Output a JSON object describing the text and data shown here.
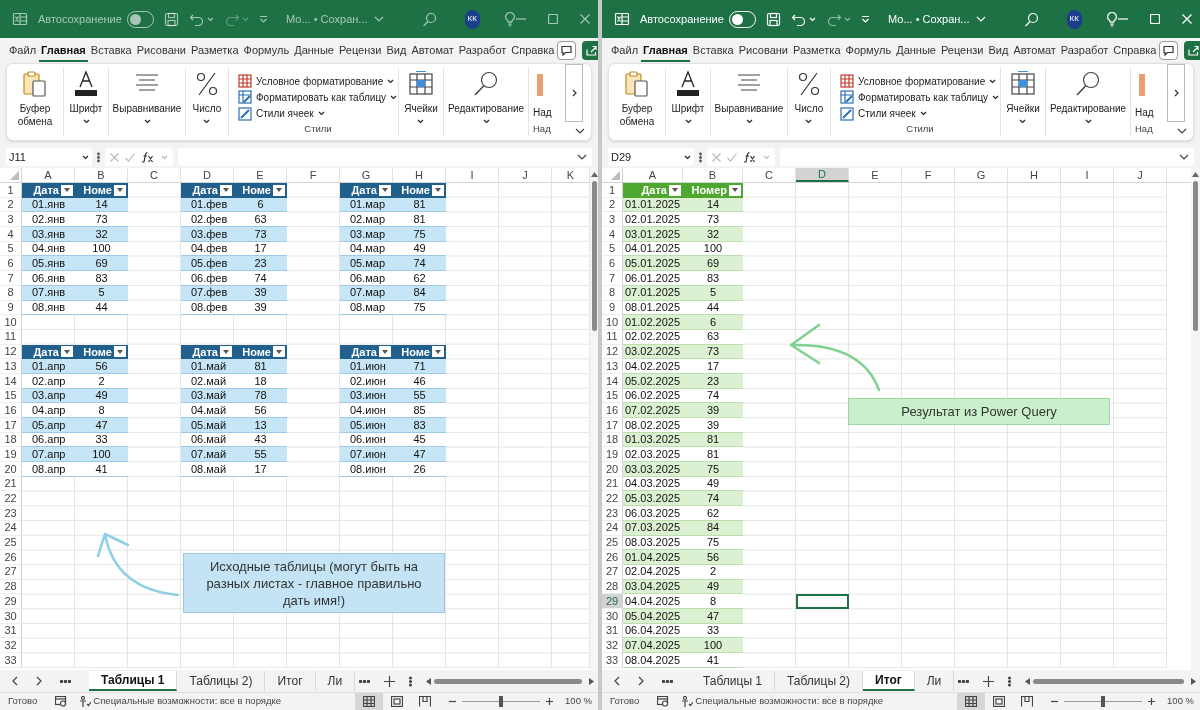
{
  "windows": [
    {
      "active": false,
      "title_bar": {
        "autosave_label": "Автосохранение",
        "autosave_on": false,
        "doc_title": "Мо... • Сохран...",
        "avatar": "КК"
      },
      "menu_tabs": [
        {
          "label": "Файл",
          "selected": false
        },
        {
          "label": "Главная",
          "selected": true
        },
        {
          "label": "Вставка",
          "selected": false
        },
        {
          "label": "Рисовани",
          "selected": false
        },
        {
          "label": "Разметка",
          "selected": false
        },
        {
          "label": "Формуль",
          "selected": false
        },
        {
          "label": "Данные",
          "selected": false
        },
        {
          "label": "Рецензи",
          "selected": false
        },
        {
          "label": "Вид",
          "selected": false
        },
        {
          "label": "Автомат",
          "selected": false
        },
        {
          "label": "Разработ",
          "selected": false
        },
        {
          "label": "Справка",
          "selected": false
        }
      ],
      "ribbon": {
        "groups": [
          {
            "kind": "clipboard",
            "label": "Буфер обмена"
          },
          {
            "kind": "font",
            "label": "Шрифт"
          },
          {
            "kind": "align",
            "label": "Выравнивание"
          },
          {
            "kind": "number",
            "label": "Число"
          },
          {
            "kind": "styles",
            "items": [
              "Условное форматирование",
              "Форматировать как таблицу",
              "Стили ячеек"
            ],
            "label": "Стили"
          },
          {
            "kind": "cells",
            "label": "Ячейки"
          },
          {
            "kind": "editing",
            "label": "Редактирование"
          },
          {
            "kind": "cut",
            "label": "Над",
            "footer": "Над"
          }
        ]
      },
      "name_box": "J11",
      "sheet": {
        "columns": [
          {
            "label": "A",
            "selected": false
          },
          {
            "label": "B",
            "selected": false
          },
          {
            "label": "C",
            "selected": false
          },
          {
            "label": "D",
            "selected": false
          },
          {
            "label": "E",
            "selected": false
          },
          {
            "label": "F",
            "selected": false
          },
          {
            "label": "G",
            "selected": false
          },
          {
            "label": "H",
            "selected": false
          },
          {
            "label": "I",
            "selected": false
          },
          {
            "label": "J",
            "selected": false
          },
          {
            "label": "K",
            "selected": false
          }
        ],
        "rows": [
          {
            "label": "1",
            "selected": false
          },
          {
            "label": "2",
            "selected": false
          },
          {
            "label": "3",
            "selected": false
          },
          {
            "label": "4",
            "selected": false
          },
          {
            "label": "5",
            "selected": false
          },
          {
            "label": "6",
            "selected": false
          },
          {
            "label": "7",
            "selected": false
          },
          {
            "label": "8",
            "selected": false
          },
          {
            "label": "9",
            "selected": false
          },
          {
            "label": "10",
            "selected": false
          },
          {
            "label": "11",
            "selected": false
          },
          {
            "label": "12",
            "selected": false
          },
          {
            "label": "13",
            "selected": false
          },
          {
            "label": "14",
            "selected": false
          },
          {
            "label": "15",
            "selected": false
          },
          {
            "label": "16",
            "selected": false
          },
          {
            "label": "17",
            "selected": false
          },
          {
            "label": "18",
            "selected": false
          },
          {
            "label": "19",
            "selected": false
          },
          {
            "label": "20",
            "selected": false
          },
          {
            "label": "21",
            "selected": false
          },
          {
            "label": "22",
            "selected": false
          },
          {
            "label": "23",
            "selected": false
          },
          {
            "label": "24",
            "selected": false
          },
          {
            "label": "25",
            "selected": false
          },
          {
            "label": "26",
            "selected": false
          },
          {
            "label": "27",
            "selected": false
          },
          {
            "label": "28",
            "selected": false
          },
          {
            "label": "29",
            "selected": false
          },
          {
            "label": "30",
            "selected": false
          },
          {
            "label": "31",
            "selected": false
          },
          {
            "label": "32",
            "selected": false
          },
          {
            "label": "33",
            "selected": false
          }
        ],
        "tables": [
          {
            "header": [
              "Дата",
              "Номе"
            ],
            "rows": [
              [
                "01.янв",
                "14"
              ],
              [
                "02.янв",
                "73"
              ],
              [
                "03.янв",
                "32"
              ],
              [
                "04.янв",
                "100"
              ],
              [
                "05.янв",
                "69"
              ],
              [
                "06.янв",
                "83"
              ],
              [
                "07.янв",
                "5"
              ],
              [
                "08.янв",
                "44"
              ]
            ]
          },
          {
            "header": [
              "Дата",
              "Номе"
            ],
            "rows": [
              [
                "01.фев",
                "6"
              ],
              [
                "02.фев",
                "63"
              ],
              [
                "03.фев",
                "73"
              ],
              [
                "04.фев",
                "17"
              ],
              [
                "05.фев",
                "23"
              ],
              [
                "06.фев",
                "74"
              ],
              [
                "07.фев",
                "39"
              ],
              [
                "08.фев",
                "39"
              ]
            ]
          },
          {
            "header": [
              "Дата",
              "Номе"
            ],
            "rows": [
              [
                "01.мар",
                "81"
              ],
              [
                "02.мар",
                "81"
              ],
              [
                "03.мар",
                "75"
              ],
              [
                "04.мар",
                "49"
              ],
              [
                "05.мар",
                "74"
              ],
              [
                "06.мар",
                "62"
              ],
              [
                "07.мар",
                "84"
              ],
              [
                "08.мар",
                "75"
              ]
            ]
          },
          {
            "header": [
              "Дата",
              "Номе"
            ],
            "rows": [
              [
                "01.апр",
                "56"
              ],
              [
                "02.апр",
                "2"
              ],
              [
                "03.апр",
                "49"
              ],
              [
                "04.апр",
                "8"
              ],
              [
                "05.апр",
                "47"
              ],
              [
                "06.апр",
                "33"
              ],
              [
                "07.апр",
                "100"
              ],
              [
                "08.апр",
                "41"
              ]
            ]
          },
          {
            "header": [
              "Дата",
              "Номе"
            ],
            "rows": [
              [
                "01.май",
                "81"
              ],
              [
                "02.май",
                "18"
              ],
              [
                "03.май",
                "78"
              ],
              [
                "04.май",
                "56"
              ],
              [
                "05.май",
                "13"
              ],
              [
                "06.май",
                "43"
              ],
              [
                "07.май",
                "55"
              ],
              [
                "08.май",
                "17"
              ]
            ]
          },
          {
            "header": [
              "Дата",
              "Номе"
            ],
            "rows": [
              [
                "01.июн",
                "71"
              ],
              [
                "02.июн",
                "46"
              ],
              [
                "03.июн",
                "55"
              ],
              [
                "04.июн",
                "85"
              ],
              [
                "05.июн",
                "83"
              ],
              [
                "06.июн",
                "45"
              ],
              [
                "07.июн",
                "47"
              ],
              [
                "08.июн",
                "26"
              ]
            ]
          }
        ],
        "callout": {
          "kind": "blue",
          "text": "Исходные таблицы (могут быть на разных листах - главное правильно дать имя!)"
        }
      },
      "sheet_tabs": [
        {
          "label": "Таблицы 1",
          "selected": true
        },
        {
          "label": "Таблицы 2)",
          "selected": false
        },
        {
          "label": "Итог",
          "selected": false
        },
        {
          "label": "Ли",
          "selected": false
        }
      ],
      "status": {
        "ready": "Готово",
        "accessibility": "Специальные возможности: все в порядке",
        "views": [
          {
            "kind": "normal",
            "selected": true
          },
          {
            "kind": "layout",
            "selected": false
          },
          {
            "kind": "pagebreak",
            "selected": false
          }
        ],
        "zoom": {
          "level": 0.5,
          "reading": "100 %"
        }
      }
    },
    {
      "active": true,
      "title_bar": {
        "autosave_label": "Автосохранение",
        "autosave_on": false,
        "doc_title": "Мо... • Сохран...",
        "avatar": "КК"
      },
      "menu_tabs": [
        {
          "label": "Файл",
          "selected": false
        },
        {
          "label": "Главная",
          "selected": true
        },
        {
          "label": "Вставка",
          "selected": false
        },
        {
          "label": "Рисовани",
          "selected": false
        },
        {
          "label": "Разметка",
          "selected": false
        },
        {
          "label": "Формуль",
          "selected": false
        },
        {
          "label": "Данные",
          "selected": false
        },
        {
          "label": "Рецензи",
          "selected": false
        },
        {
          "label": "Вид",
          "selected": false
        },
        {
          "label": "Автомат",
          "selected": false
        },
        {
          "label": "Разработ",
          "selected": false
        },
        {
          "label": "Справка",
          "selected": false
        }
      ],
      "ribbon": {
        "groups": [
          {
            "kind": "clipboard",
            "label": "Буфер обмена"
          },
          {
            "kind": "font",
            "label": "Шрифт"
          },
          {
            "kind": "align",
            "label": "Выравнивание"
          },
          {
            "kind": "number",
            "label": "Число"
          },
          {
            "kind": "styles",
            "items": [
              "Условное форматирование",
              "Форматировать как таблицу",
              "Стили ячеек"
            ],
            "label": "Стили"
          },
          {
            "kind": "cells",
            "label": "Ячейки"
          },
          {
            "kind": "editing",
            "label": "Редактирование"
          },
          {
            "kind": "cut",
            "label": "Над",
            "footer": "Над"
          }
        ]
      },
      "name_box": "D29",
      "sheet": {
        "columns": [
          {
            "label": "A",
            "selected": false
          },
          {
            "label": "B",
            "selected": false
          },
          {
            "label": "C",
            "selected": false
          },
          {
            "label": "D",
            "selected": true
          },
          {
            "label": "E",
            "selected": false
          },
          {
            "label": "F",
            "selected": false
          },
          {
            "label": "G",
            "selected": false
          },
          {
            "label": "H",
            "selected": false
          },
          {
            "label": "I",
            "selected": false
          },
          {
            "label": "J",
            "selected": false
          }
        ],
        "rows": [
          {
            "label": "1",
            "selected": false
          },
          {
            "label": "2",
            "selected": false
          },
          {
            "label": "3",
            "selected": false
          },
          {
            "label": "4",
            "selected": false
          },
          {
            "label": "5",
            "selected": false
          },
          {
            "label": "6",
            "selected": false
          },
          {
            "label": "7",
            "selected": false
          },
          {
            "label": "8",
            "selected": false
          },
          {
            "label": "9",
            "selected": false
          },
          {
            "label": "10",
            "selected": false
          },
          {
            "label": "11",
            "selected": false
          },
          {
            "label": "12",
            "selected": false
          },
          {
            "label": "13",
            "selected": false
          },
          {
            "label": "14",
            "selected": false
          },
          {
            "label": "15",
            "selected": false
          },
          {
            "label": "16",
            "selected": false
          },
          {
            "label": "17",
            "selected": false
          },
          {
            "label": "18",
            "selected": false
          },
          {
            "label": "19",
            "selected": false
          },
          {
            "label": "20",
            "selected": false
          },
          {
            "label": "21",
            "selected": false
          },
          {
            "label": "22",
            "selected": false
          },
          {
            "label": "23",
            "selected": false
          },
          {
            "label": "24",
            "selected": false
          },
          {
            "label": "25",
            "selected": false
          },
          {
            "label": "26",
            "selected": false
          },
          {
            "label": "27",
            "selected": false
          },
          {
            "label": "28",
            "selected": false
          },
          {
            "label": "29",
            "selected": true
          },
          {
            "label": "30",
            "selected": false
          },
          {
            "label": "31",
            "selected": false
          },
          {
            "label": "32",
            "selected": false
          },
          {
            "label": "33",
            "selected": false
          }
        ],
        "tables": [
          {
            "header": [
              "Дата",
              "Номер"
            ],
            "rows": [
              [
                "01.01.2025",
                "14"
              ],
              [
                "02.01.2025",
                "73"
              ],
              [
                "03.01.2025",
                "32"
              ],
              [
                "04.01.2025",
                "100"
              ],
              [
                "05.01.2025",
                "69"
              ],
              [
                "06.01.2025",
                "83"
              ],
              [
                "07.01.2025",
                "5"
              ],
              [
                "08.01.2025",
                "44"
              ],
              [
                "01.02.2025",
                "6"
              ],
              [
                "02.02.2025",
                "63"
              ],
              [
                "03.02.2025",
                "73"
              ],
              [
                "04.02.2025",
                "17"
              ],
              [
                "05.02.2025",
                "23"
              ],
              [
                "06.02.2025",
                "74"
              ],
              [
                "07.02.2025",
                "39"
              ],
              [
                "08.02.2025",
                "39"
              ],
              [
                "01.03.2025",
                "81"
              ],
              [
                "02.03.2025",
                "81"
              ],
              [
                "03.03.2025",
                "75"
              ],
              [
                "04.03.2025",
                "49"
              ],
              [
                "05.03.2025",
                "74"
              ],
              [
                "06.03.2025",
                "62"
              ],
              [
                "07.03.2025",
                "84"
              ],
              [
                "08.03.2025",
                "75"
              ],
              [
                "01.04.2025",
                "56"
              ],
              [
                "02.04.2025",
                "2"
              ],
              [
                "03.04.2025",
                "49"
              ],
              [
                "04.04.2025",
                "8"
              ],
              [
                "05.04.2025",
                "47"
              ],
              [
                "06.04.2025",
                "33"
              ],
              [
                "07.04.2025",
                "100"
              ],
              [
                "08.04.2025",
                "41"
              ]
            ]
          }
        ],
        "callout": {
          "kind": "green",
          "text": "Результат из Power Query"
        }
      },
      "sheet_tabs": [
        {
          "label": "Таблицы 1",
          "selected": false
        },
        {
          "label": "Таблицы 2)",
          "selected": false
        },
        {
          "label": "Итог",
          "selected": true
        },
        {
          "label": "Ли",
          "selected": false
        }
      ],
      "status": {
        "ready": "Готово",
        "accessibility": "Специальные возможности: все в порядке",
        "views": [
          {
            "kind": "normal",
            "selected": true
          },
          {
            "kind": "layout",
            "selected": false
          },
          {
            "kind": "pagebreak",
            "selected": false
          }
        ],
        "zoom": {
          "level": 0.5,
          "reading": "100 %"
        }
      }
    }
  ]
}
